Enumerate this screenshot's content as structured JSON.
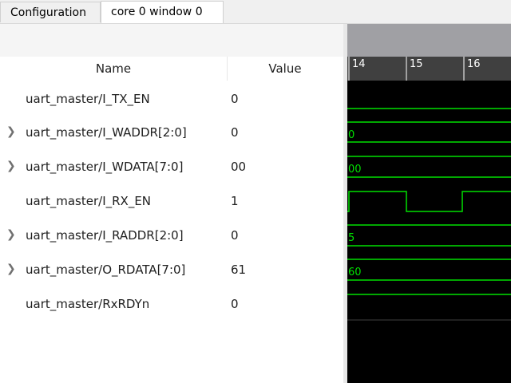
{
  "tabs": [
    {
      "label": "Configuration",
      "active": false
    },
    {
      "label": "core 0 window 0",
      "active": true
    }
  ],
  "columns": {
    "name": "Name",
    "value": "Value"
  },
  "signals": [
    {
      "name": "uart_master/I_TX_EN",
      "value": "0",
      "expandable": false
    },
    {
      "name": "uart_master/I_WADDR[2:0]",
      "value": "0",
      "expandable": true
    },
    {
      "name": "uart_master/I_WDATA[7:0]",
      "value": "00",
      "expandable": true
    },
    {
      "name": "uart_master/I_RX_EN",
      "value": "1",
      "expandable": false
    },
    {
      "name": "uart_master/I_RADDR[2:0]",
      "value": "0",
      "expandable": true
    },
    {
      "name": "uart_master/O_RDATA[7:0]",
      "value": "61",
      "expandable": true
    },
    {
      "name": "uart_master/RxRDYn",
      "value": "0",
      "expandable": false
    }
  ],
  "ruler": {
    "ticks": [
      "14",
      "15",
      "16"
    ]
  },
  "wave_labels": {
    "waddr": "0",
    "wdata": "00",
    "raddr": "5",
    "rdata": "60"
  },
  "colors": {
    "wave_green": "#00e000",
    "wave_bg": "#000000",
    "ruler_bg": "#404040",
    "wave_header": "#a0a0a4",
    "chevron": "#707070"
  },
  "icons": {
    "expand": "chevron-right-icon"
  }
}
